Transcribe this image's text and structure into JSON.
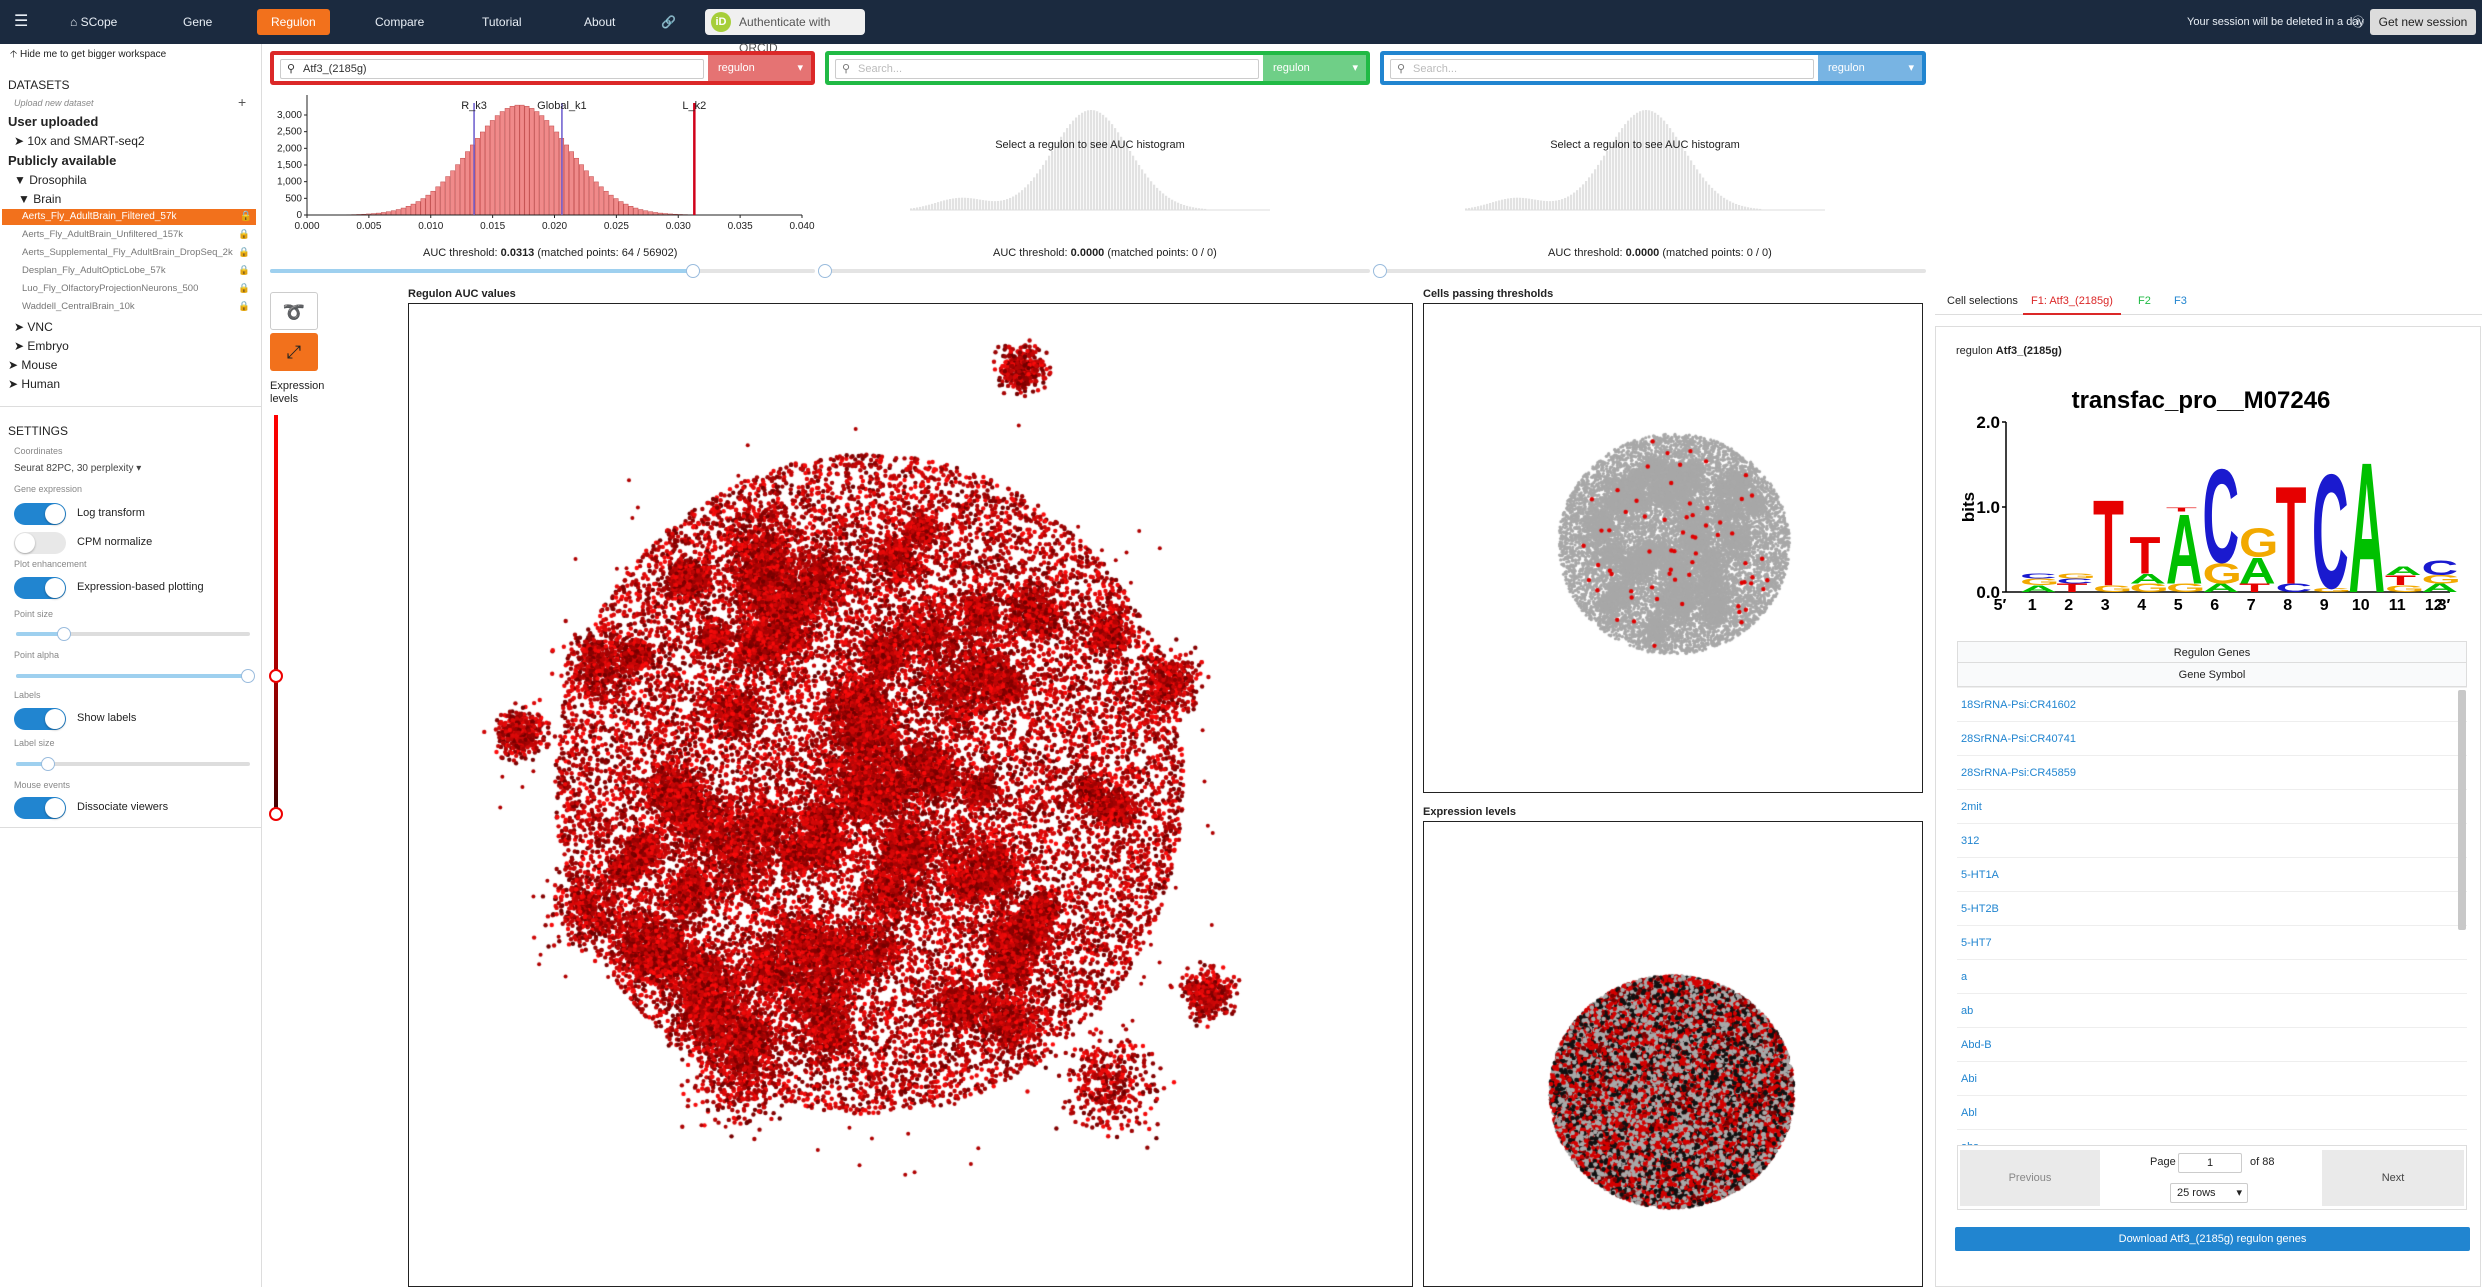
{
  "topbar": {
    "menu_icon": "hamburger-icon",
    "brand": "SCope",
    "nav": [
      "Gene",
      "Regulon",
      "Compare",
      "Tutorial",
      "About"
    ],
    "active_nav": "Regulon",
    "orcid_label": "Authenticate with ORCID",
    "session_text": "Your session will be deleted in a day",
    "new_session_label": "Get new session"
  },
  "sidebar": {
    "hide_label": "Hide me to get bigger workspace",
    "datasets_title": "DATASETS",
    "upload_label": "Upload new dataset",
    "user_uploaded": "User uploaded",
    "user_item": "10x and SMART-seq2",
    "public_title": "Publicly available",
    "drosophila": "Drosophila",
    "brain": "Brain",
    "datasets": [
      "Aerts_Fly_AdultBrain_Filtered_57k",
      "Aerts_Fly_AdultBrain_Unfiltered_157k",
      "Aerts_Supplemental_Fly_AdultBrain_DropSeq_2k",
      "Desplan_Fly_AdultOpticLobe_57k",
      "Luo_Fly_OlfactoryProjectionNeurons_500",
      "Waddell_CentralBrain_10k"
    ],
    "other_groups": [
      "VNC",
      "Embryo",
      "Mouse",
      "Human"
    ],
    "settings_title": "SETTINGS",
    "coordinates_label": "Coordinates",
    "coordinates_value": "Seurat 82PC, 30 perplexity",
    "gene_expression_label": "Gene expression",
    "log_transform": "Log transform",
    "cpm_normalize": "CPM normalize",
    "plot_enhancement_label": "Plot enhancement",
    "expression_plotting": "Expression-based plotting",
    "point_size_label": "Point size",
    "point_alpha_label": "Point alpha",
    "labels_label": "Labels",
    "show_labels": "Show labels",
    "label_size_label": "Label size",
    "mouse_events_label": "Mouse events",
    "dissociate_viewers": "Dissociate viewers",
    "toggles": {
      "log_transform": true,
      "cpm_normalize": false,
      "expression_plotting": true,
      "show_labels": true,
      "dissociate_viewers": true
    },
    "sliders": {
      "point_size": 0.21,
      "point_alpha": 1.0,
      "label_size": 0.14
    }
  },
  "queries": [
    {
      "value": "Atf3_(2185g)",
      "placeholder": "",
      "type": "regulon",
      "color": "#db2828",
      "sel_color": "#e57373"
    },
    {
      "value": "",
      "placeholder": "Search...",
      "type": "regulon",
      "color": "#21ba45",
      "sel_color": "#6fcf87"
    },
    {
      "value": "",
      "placeholder": "Search...",
      "type": "regulon",
      "color": "#2185d0",
      "sel_color": "#78b4e3"
    }
  ],
  "histogram": {
    "markers": [
      "R_k3",
      "Global_k1",
      "L_k2"
    ],
    "marker_values": [
      0.0135,
      0.0206,
      0.0313
    ],
    "y_ticks": [
      "3,000",
      "2,500",
      "2,000",
      "1,500",
      "1,000",
      "500",
      "0"
    ],
    "x_ticks": [
      "0.000",
      "0.005",
      "0.010",
      "0.015",
      "0.020",
      "0.025",
      "0.030",
      "0.035",
      "0.040"
    ],
    "threshold_prefix": "AUC threshold: ",
    "threshold_value": "0.0313",
    "matched_text": " (matched points: 64 / 56902)",
    "threshold_slider": 0.86,
    "empty_text": "Select a regulon to see AUC histogram",
    "empty_threshold_value": "0.0000",
    "empty_matched_text": " (matched points: 0 / 0)"
  },
  "tools": {
    "lasso_icon": "lasso-icon",
    "expand_icon": "expand-icon",
    "expression_levels": "Expression levels"
  },
  "panels": {
    "auc_title": "Regulon AUC values",
    "passing_title": "Cells passing thresholds",
    "expression_title": "Expression levels"
  },
  "right": {
    "tabs": [
      "Cell selections",
      "F1: Atf3_(2185g)",
      "F2",
      "F3"
    ],
    "tab_colors": [
      "#222222",
      "#db2828",
      "#21ba45",
      "#2185d0"
    ],
    "regulon_prefix": "regulon ",
    "regulon_name": "Atf3_(2185g)",
    "motif_title": "transfac_pro__M07246",
    "logo_y_label": "bits",
    "logo_y_ticks": [
      "2.0",
      "1.0",
      "0.0"
    ],
    "logo_positions": [
      "5′",
      "1",
      "2",
      "3",
      "4",
      "5",
      "6",
      "7",
      "8",
      "9",
      "10",
      "11",
      "12",
      "3′"
    ],
    "table_title": "Regulon Genes",
    "col_header": "Gene Symbol",
    "genes": [
      "18SrRNA-Psi:CR41602",
      "28SrRNA-Psi:CR40741",
      "28SrRNA-Psi:CR45859",
      "2mit",
      "312",
      "5-HT1A",
      "5-HT2B",
      "5-HT7",
      "a",
      "ab",
      "Abd-B",
      "Abi",
      "Abl",
      "abs"
    ],
    "prev_label": "Previous",
    "next_label": "Next",
    "page_label": "Page",
    "page_value": "1",
    "of_label": "of 88",
    "rows_value": "25 rows",
    "download_label": "Download Atf3_(2185g) regulon genes"
  }
}
